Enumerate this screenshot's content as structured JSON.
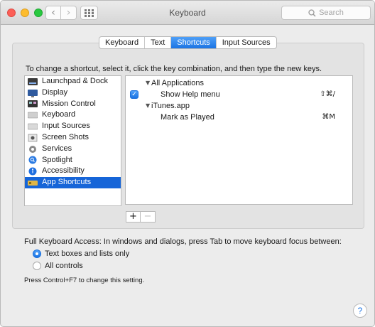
{
  "window": {
    "title": "Keyboard"
  },
  "toolbar": {
    "back_glyph": "‹",
    "forward_glyph": "›",
    "search_placeholder": "Search"
  },
  "tabs": [
    {
      "label": "Keyboard",
      "active": false
    },
    {
      "label": "Text",
      "active": false
    },
    {
      "label": "Shortcuts",
      "active": true
    },
    {
      "label": "Input Sources",
      "active": false
    }
  ],
  "instructions": "To change a shortcut, select it, click the key combination, and then type the new keys.",
  "categories": [
    {
      "label": "Launchpad & Dock",
      "icon": "launchpad-icon"
    },
    {
      "label": "Display",
      "icon": "display-icon"
    },
    {
      "label": "Mission Control",
      "icon": "mission-control-icon"
    },
    {
      "label": "Keyboard",
      "icon": "keyboard-icon"
    },
    {
      "label": "Input Sources",
      "icon": "input-sources-icon"
    },
    {
      "label": "Screen Shots",
      "icon": "screenshot-icon"
    },
    {
      "label": "Services",
      "icon": "gear-icon"
    },
    {
      "label": "Spotlight",
      "icon": "spotlight-icon"
    },
    {
      "label": "Accessibility",
      "icon": "accessibility-icon"
    },
    {
      "label": "App Shortcuts",
      "icon": "app-shortcuts-icon",
      "selected": true
    }
  ],
  "shortcuts": {
    "group1": "All Applications",
    "item1": {
      "name": "Show Help menu",
      "keys": "⇧⌘/",
      "checked": true
    },
    "group2": "iTunes.app",
    "item2": {
      "name": "Mark as Played",
      "keys": "⌘M"
    }
  },
  "buttons": {
    "add": "+",
    "remove": "−"
  },
  "full_keyboard_access": {
    "label": "Full Keyboard Access: In windows and dialogs, press Tab to move keyboard focus between:",
    "options": [
      {
        "label": "Text boxes and lists only",
        "selected": true
      },
      {
        "label": "All controls",
        "selected": false
      }
    ],
    "note": "Press Control+F7 to change this setting."
  },
  "help_label": "?",
  "colors": {
    "accent": "#1b74e3",
    "selection": "#1665d8"
  }
}
